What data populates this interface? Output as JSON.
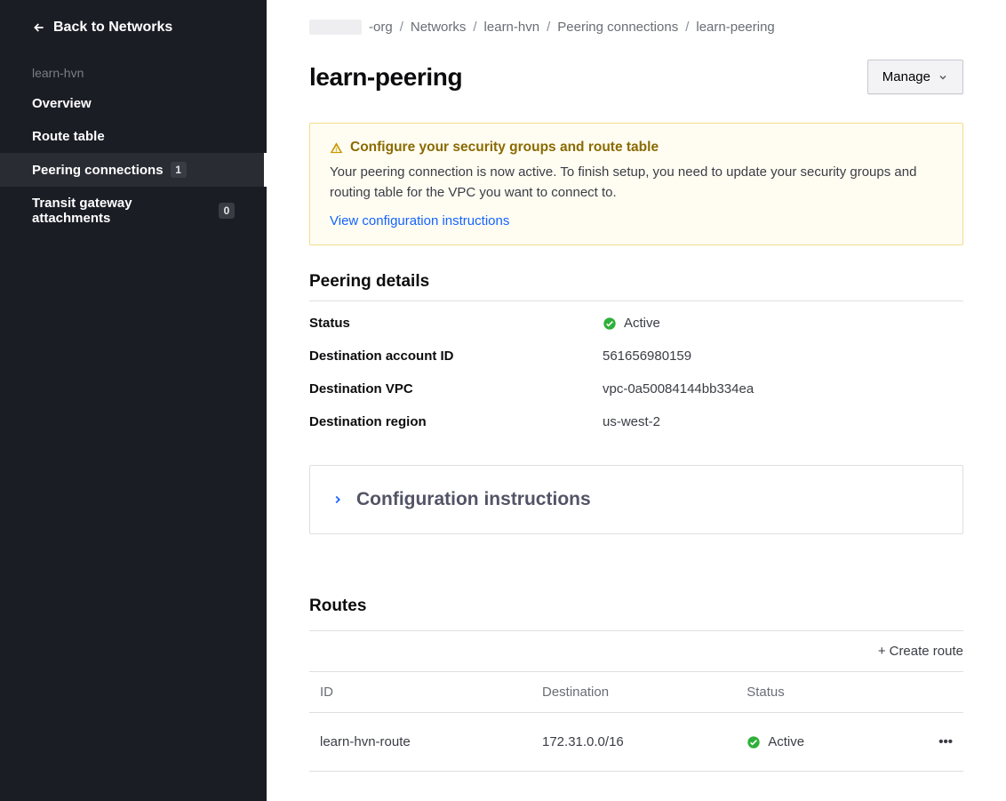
{
  "sidebar": {
    "back_label": "Back to Networks",
    "context_name": "learn-hvn",
    "items": [
      {
        "label": "Overview",
        "badge": null,
        "active": false
      },
      {
        "label": "Route table",
        "badge": null,
        "active": false
      },
      {
        "label": "Peering connections",
        "badge": "1",
        "active": true
      },
      {
        "label": "Transit gateway attachments",
        "badge": "0",
        "active": false
      }
    ]
  },
  "breadcrumbs": {
    "items": [
      "-org",
      "Networks",
      "learn-hvn",
      "Peering connections",
      "learn-peering"
    ]
  },
  "page": {
    "title": "learn-peering",
    "manage_label": "Manage"
  },
  "alert": {
    "title": "Configure your security groups and route table",
    "body": "Your peering connection is now active. To finish setup, you need to update your security groups and routing table for the VPC you want to connect to.",
    "link_label": "View configuration instructions"
  },
  "details": {
    "section_title": "Peering details",
    "rows": [
      {
        "label": "Status",
        "value": "Active",
        "is_status": true
      },
      {
        "label": "Destination account ID",
        "value": "561656980159",
        "is_status": false
      },
      {
        "label": "Destination VPC",
        "value": "vpc-0a50084144bb334ea",
        "is_status": false
      },
      {
        "label": "Destination region",
        "value": "us-west-2",
        "is_status": false
      }
    ]
  },
  "config_panel": {
    "title": "Configuration instructions"
  },
  "routes": {
    "section_title": "Routes",
    "create_label": "Create route",
    "columns": [
      "ID",
      "Destination",
      "Status",
      ""
    ],
    "rows": [
      {
        "id": "learn-hvn-route",
        "destination": "172.31.0.0/16",
        "status": "Active"
      }
    ]
  }
}
